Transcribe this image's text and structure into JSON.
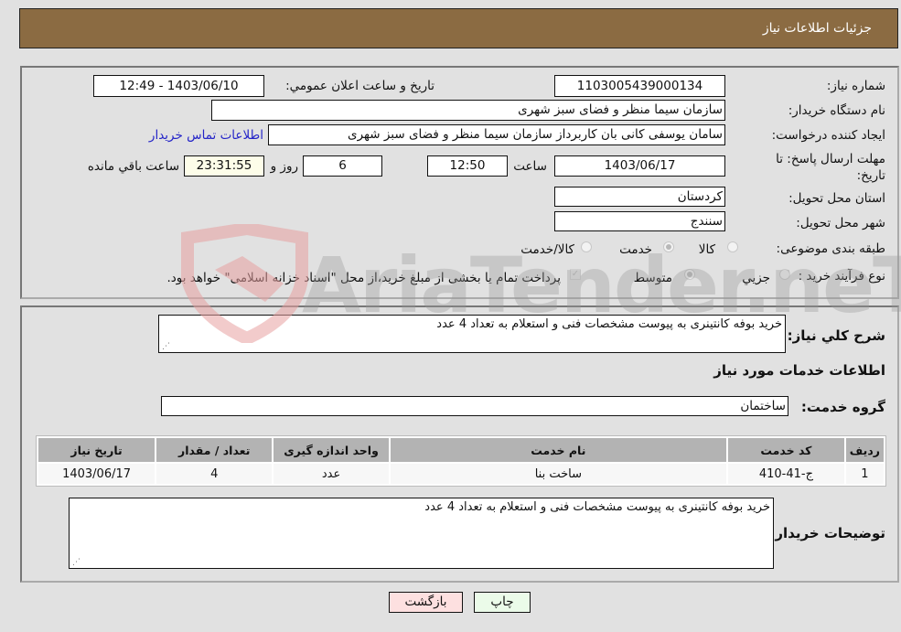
{
  "header": {
    "title": "جزئیات اطلاعات نیاز"
  },
  "form": {
    "need_number": {
      "label": "شماره نیاز:",
      "value": "1103005439000134"
    },
    "announce_datetime": {
      "label": "تاریخ و ساعت اعلان عمومي:",
      "value": "1403/06/10 - 12:49"
    },
    "buyer_org": {
      "label": "نام دستگاه خريدار:",
      "value": "سازمان سیما  منظر و فضای سبز شهری"
    },
    "requester": {
      "label": "ایجاد کننده درخواست:",
      "value": "سامان یوسفی کانی بان کاربرداز سازمان سیما  منظر و فضای سبز شهری"
    },
    "contact_link": "اطلاعات تماس خريدار",
    "deadline": {
      "label": "مهلت ارسال پاسخ: تا تاريخ:",
      "date": "1403/06/17",
      "time_label": "ساعت",
      "time": "12:50",
      "days": "6",
      "days_label": "روز و",
      "remaining": "23:31:55",
      "remaining_label": "ساعت باقي مانده"
    },
    "province": {
      "label": "استان محل تحويل:",
      "value": "کردستان"
    },
    "city": {
      "label": "شهر محل تحويل:",
      "value": "سنندج"
    },
    "category": {
      "label": "طبقه بندی موضوعی:",
      "options": [
        "کالا",
        "خدمت",
        "کالا/خدمت"
      ],
      "selected": "خدمت"
    },
    "purchase_type": {
      "label": "نوع فرآیند خرید :",
      "options": [
        "جزيي",
        "متوسط"
      ],
      "selected": "متوسط",
      "treasury_note": "پرداخت تمام یا بخشی از مبلغ خرید،از محل \"اسناد خزانه اسلامی\" خواهد بود.",
      "treasury_checked": true
    }
  },
  "details": {
    "summary_label": "شرح کلي نياز:",
    "summary_value": "خرید بوفه کانتینری به پیوست مشخصات فنی و استعلام به تعداد 4 عدد",
    "services_heading": "اطلاعات خدمات مورد نياز",
    "service_group_label": "گروه خدمت:",
    "service_group_value": "ساختمان",
    "table": {
      "headers": [
        "رديف",
        "کد خدمت",
        "نام خدمت",
        "واحد اندازه گيری",
        "تعداد / مقدار",
        "تاريخ نياز"
      ],
      "rows": [
        [
          "1",
          "ج-41-410",
          "ساخت بنا",
          "عدد",
          "4",
          "1403/06/17"
        ]
      ]
    },
    "buyer_notes_label": "توضيحات خريدار:",
    "buyer_notes_value": "خرید بوفه کانتینری به پیوست مشخصات فنی و استعلام به تعداد 4 عدد"
  },
  "buttons": {
    "print": "چاپ",
    "back": "بازگشت"
  },
  "colors": {
    "header_bg": "#8b6b42",
    "print_bg": "#ebfbe9",
    "back_bg": "#fde0e0",
    "link": "#2424c8"
  },
  "watermark": "AriaTender.neT"
}
